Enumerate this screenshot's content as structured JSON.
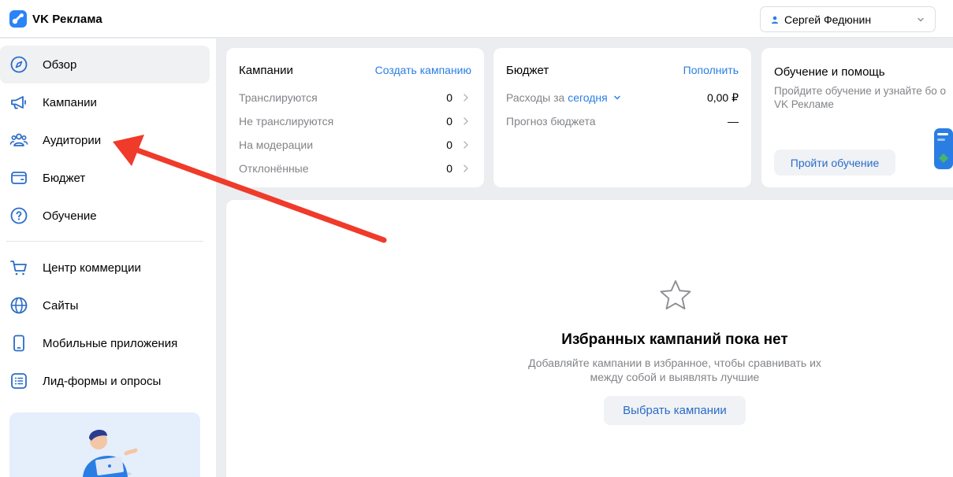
{
  "header": {
    "logo_text": "VK Реклама",
    "user_name": "Сергей Федюнин"
  },
  "sidebar": {
    "items": [
      {
        "label": "Обзор",
        "icon": "compass-icon"
      },
      {
        "label": "Кампании",
        "icon": "megaphone-icon"
      },
      {
        "label": "Аудитории",
        "icon": "users-icon"
      },
      {
        "label": "Бюджет",
        "icon": "wallet-icon"
      },
      {
        "label": "Обучение",
        "icon": "question-icon"
      },
      {
        "label": "Центр коммерции",
        "icon": "cart-icon"
      },
      {
        "label": "Сайты",
        "icon": "globe-icon"
      },
      {
        "label": "Мобильные приложения",
        "icon": "smartphone-icon"
      },
      {
        "label": "Лид-формы и опросы",
        "icon": "list-icon"
      }
    ]
  },
  "campaigns_card": {
    "title": "Кампании",
    "link": "Создать кампанию",
    "rows": [
      {
        "label": "Транслируются",
        "value": "0"
      },
      {
        "label": "Не транслируются",
        "value": "0"
      },
      {
        "label": "На модерации",
        "value": "0"
      },
      {
        "label": "Отклонённые",
        "value": "0"
      }
    ]
  },
  "budget_card": {
    "title": "Бюджет",
    "link": "Пополнить",
    "expenses_label": "Расходы за",
    "period": "сегодня",
    "expenses_value": "0,00 ₽",
    "forecast_label": "Прогноз бюджета",
    "forecast_value": "—"
  },
  "help_card": {
    "title": "Обучение и помощь",
    "description": "Пройдите обучение и узнайте бо о VK Рекламе",
    "button": "Пройти обучение"
  },
  "favorites": {
    "title": "Избранных кампаний пока нет",
    "description_line1": "Добавляйте кампании в избранное, чтобы сравнивать их",
    "description_line2": "между собой и выявлять лучшие",
    "button": "Выбрать кампании"
  },
  "colors": {
    "accent": "#2a7ee3",
    "annotation_arrow": "#f03a2a"
  }
}
